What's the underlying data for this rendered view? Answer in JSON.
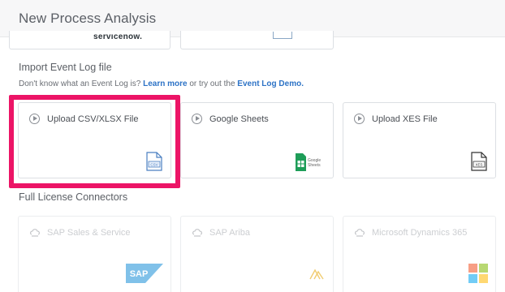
{
  "dialog": {
    "title": "New Process Analysis"
  },
  "top_row": {
    "logo_text": "servicenow."
  },
  "import_section": {
    "heading": "Import Event Log file",
    "hint_prefix": "Don't know what an Event Log is?",
    "learn_more": "Learn more",
    "hint_middle": "or try out the",
    "demo_link": "Event Log Demo."
  },
  "import_cards": [
    {
      "label": "Upload CSV/XLSX File",
      "icon": "csv-file-icon",
      "icon_text": "CSV"
    },
    {
      "label": "Google Sheets",
      "icon": "google-sheets-icon",
      "icon_text": "Google Sheets"
    },
    {
      "label": "Upload XES File",
      "icon": "xes-file-icon",
      "icon_text": "XES"
    }
  ],
  "license_section": {
    "heading": "Full License Connectors"
  },
  "license_cards": [
    {
      "label": "SAP Sales & Service",
      "icon": "sap-logo-icon",
      "icon_text": "SAP"
    },
    {
      "label": "SAP Ariba",
      "icon": "ariba-logo-icon"
    },
    {
      "label": "Microsoft Dynamics 365",
      "icon": "microsoft-logo-icon"
    }
  ],
  "colors": {
    "highlight": "#ec1466",
    "link": "#2d73c6",
    "sheets_green": "#1e9d58",
    "sap_blue": "#1a8fd8"
  }
}
